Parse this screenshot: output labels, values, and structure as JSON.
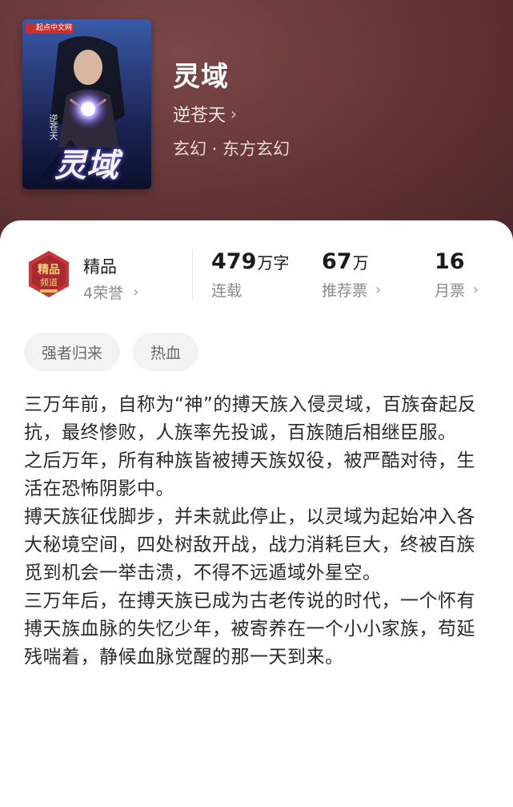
{
  "book": {
    "publisher_logo": "起点中文网",
    "cover_title_art": "灵域",
    "cover_author_art": "逆苍天",
    "title": "灵域",
    "author": "逆苍天",
    "genre": "玄幻 · 东方玄幻"
  },
  "stats": {
    "badge_icon": "jingpin-medal-icon",
    "badge_label": "精品",
    "honors": "4荣誉",
    "word_count": "479",
    "word_unit": "万字",
    "status": "连载",
    "recommend_count": "67",
    "recommend_unit": "万",
    "recommend_label": "推荐票",
    "monthly_count": "16",
    "monthly_label": "月票"
  },
  "tags": [
    "强者归来",
    "热血"
  ],
  "description": [
    "三万年前，自称为“神”的搏天族入侵灵域，百族奋起反抗，最终惨败，人族率先投诚，百族随后相继臣服。",
    "之后万年，所有种族皆被搏天族奴役，被严酷对待，生活在恐怖阴影中。",
    "搏天族征伐脚步，并未就此停止，以灵域为起始冲入各大秘境空间，四处树敌开战，战力消耗巨大，终被百族觅到机会一举击溃，不得不远遁域外星空。",
    "三万年后，在搏天族已成为古老传说的时代，一个怀有搏天族血脉的失忆少年，被寄养在一个小小家族，苟延残喘着，静候血脉觉醒的那一天到来。"
  ],
  "colors": {
    "hero_bg": "#6b3a3c",
    "badge_red": "#c8363a",
    "badge_gold": "#e8c060"
  }
}
